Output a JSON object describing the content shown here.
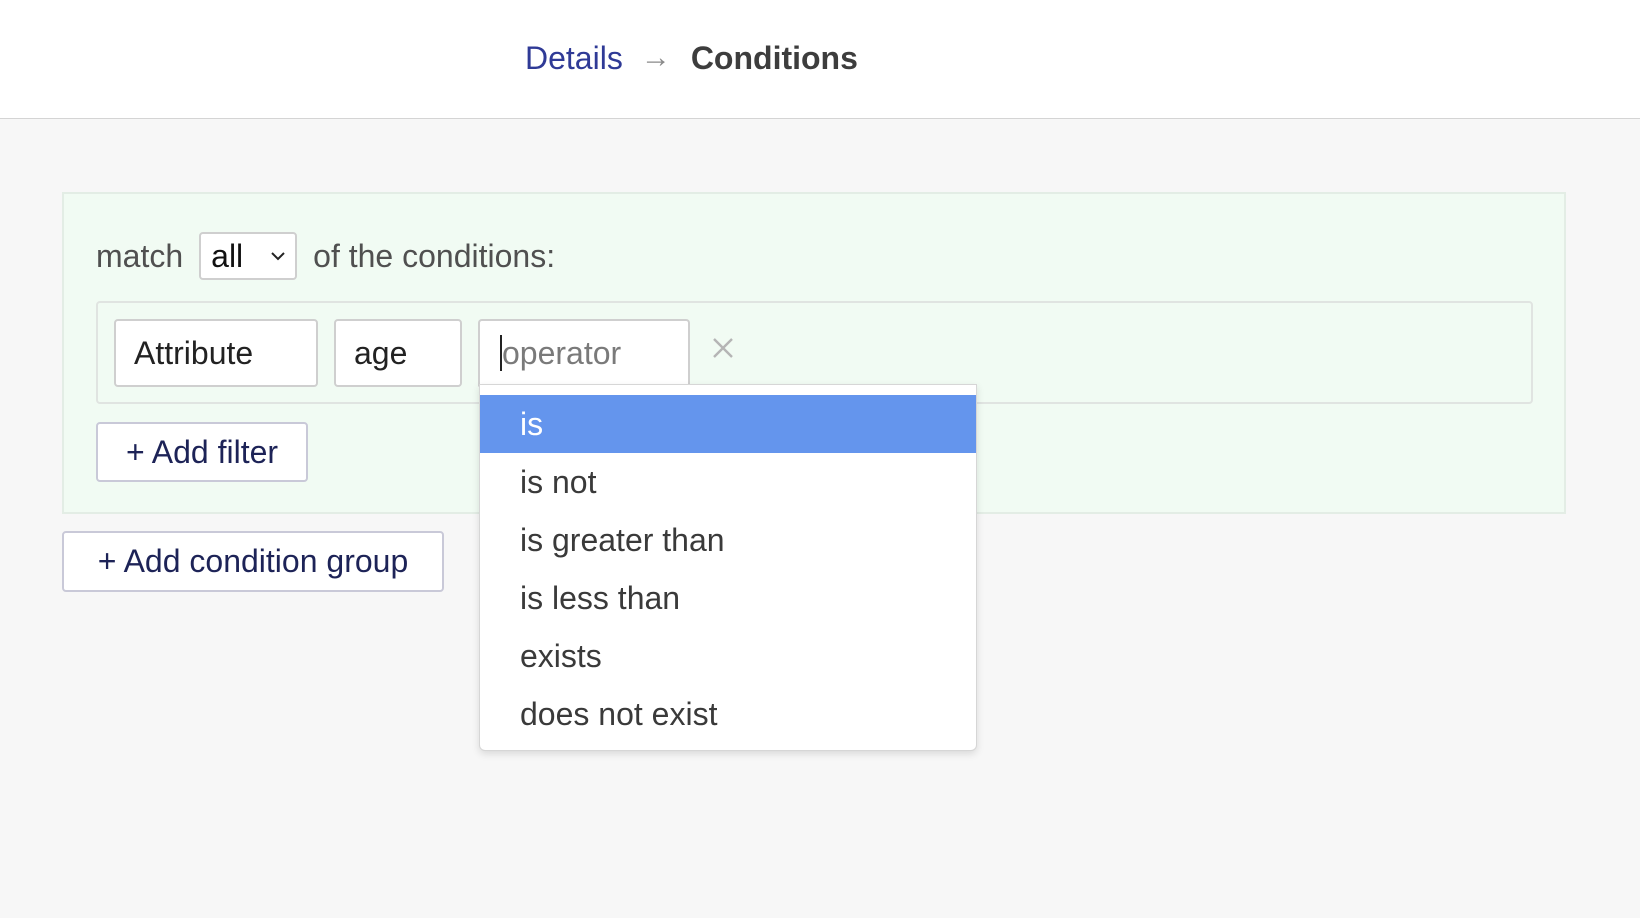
{
  "breadcrumb": {
    "link_label": "Details",
    "arrow": "→",
    "current_label": "Conditions"
  },
  "group": {
    "match_prefix": "match",
    "match_value": "all",
    "match_suffix": "of the conditions:",
    "filter": {
      "attribute_value": "Attribute",
      "key_value": "age",
      "operator_placeholder": "operator"
    },
    "add_filter_label": "+ Add filter"
  },
  "add_group_label": "+ Add condition group",
  "operator_options": {
    "items": [
      "is",
      "is not",
      "is greater than",
      "is less than",
      "exists",
      "does not exist"
    ],
    "selected": "is"
  },
  "colors": {
    "link": "#2f3a96",
    "selected_option_bg": "#6495ed",
    "group_bg": "#f1fbf3"
  },
  "icons": {
    "arrow": "right-arrow-icon",
    "select": "chevron-down-icon",
    "remove": "close-icon"
  }
}
